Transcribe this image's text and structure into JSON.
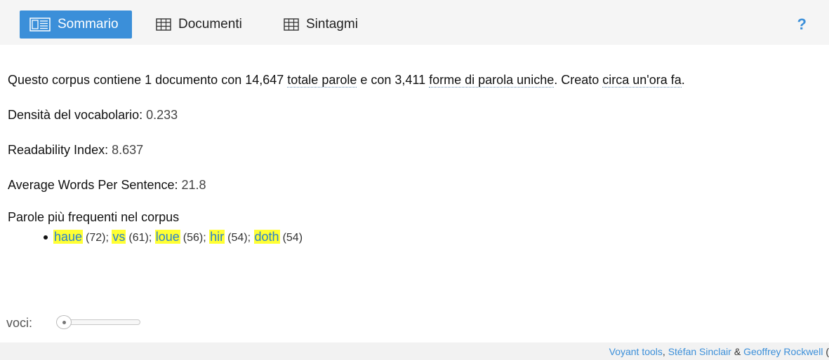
{
  "tabs": [
    {
      "label": "Sommario",
      "icon": "summary-icon",
      "active": true
    },
    {
      "label": "Documenti",
      "icon": "table-icon",
      "active": false
    },
    {
      "label": "Sintagmi",
      "icon": "table-icon",
      "active": false
    }
  ],
  "help": {
    "label": "?"
  },
  "summary": {
    "intro_1": "Questo corpus contiene 1 documento con 14,647 ",
    "total_words_link": "totale parole",
    "intro_2": " e con 3,411 ",
    "unique_forms_link": "forme di parola uniche",
    "intro_3": ". Creato ",
    "created_link": "circa un'ora fa",
    "intro_4": ".",
    "density_label": "Densità del vocabolario:",
    "density_value": "0.233",
    "readability_label": "Readability Index:",
    "readability_value": "8.637",
    "avg_words_label": "Average Words Per Sentence:",
    "avg_words_value": "21.8",
    "frequent_title": "Parole più frequenti nel corpus"
  },
  "frequent_words": [
    {
      "word": "haue",
      "count": "(72)",
      "sep": ";"
    },
    {
      "word": "vs",
      "count": "(61)",
      "sep": ";"
    },
    {
      "word": "loue",
      "count": "(56)",
      "sep": ";"
    },
    {
      "word": "hir",
      "count": "(54)",
      "sep": ";"
    },
    {
      "word": "doth",
      "count": "(54)",
      "sep": ""
    }
  ],
  "voci": {
    "label": "voci:",
    "slider_position": 0
  },
  "footer": {
    "link1": "Voyant tools",
    "sep1": ", ",
    "link2": "Stéfan Sinclair",
    "sep2": " & ",
    "link3": "Geoffrey Rockwell",
    "tail": " ("
  },
  "colors": {
    "accent": "#3b8fd9",
    "highlight": "#ffff33"
  }
}
